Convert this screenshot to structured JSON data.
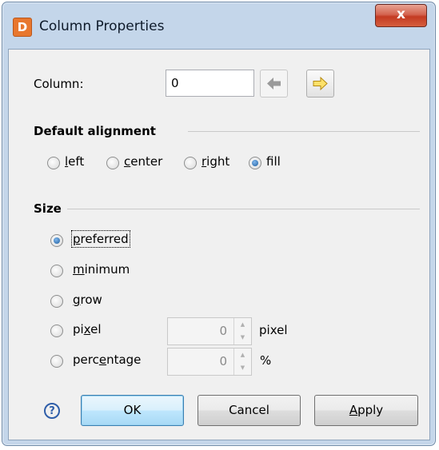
{
  "window": {
    "title": "Column Properties",
    "app_icon_glyph": "D",
    "close_glyph": "x"
  },
  "column": {
    "label": "Column:",
    "value": "0",
    "prev_icon": "arrow-left-icon",
    "next_icon": "arrow-right-icon"
  },
  "alignment": {
    "title": "Default alignment",
    "options": [
      {
        "id": "left",
        "mnemonic": "l",
        "rest": "eft",
        "selected": false
      },
      {
        "id": "center",
        "mnemonic": "c",
        "rest": "enter",
        "selected": false
      },
      {
        "id": "right",
        "mnemonic": "r",
        "rest": "ight",
        "selected": false
      },
      {
        "id": "fill",
        "pre": "f",
        "mnemonic": "i",
        "rest": "ll",
        "selected": true
      }
    ]
  },
  "size": {
    "title": "Size",
    "options": [
      {
        "id": "preferred",
        "mnemonic": "p",
        "rest": "referred",
        "selected": true,
        "focused": true
      },
      {
        "id": "minimum",
        "mnemonic": "m",
        "rest": "inimum",
        "selected": false
      },
      {
        "id": "grow",
        "mnemonic": "g",
        "rest": "row",
        "selected": false
      },
      {
        "id": "pixel",
        "pre": "pi",
        "mnemonic": "x",
        "rest": "el",
        "selected": false
      },
      {
        "id": "percentage",
        "pre": "perc",
        "mnemonic": "e",
        "rest": "ntage",
        "selected": false
      }
    ],
    "pixel_value": "0",
    "pixel_unit": "pixel",
    "percent_value": "0",
    "percent_unit": "%"
  },
  "buttons": {
    "help_glyph": "?",
    "ok": "OK",
    "cancel": "Cancel",
    "apply_mnemonic": "A",
    "apply_rest": "pply"
  },
  "colors": {
    "accent": "#3c7fb1",
    "app_icon": "#e8772e",
    "close": "#c33a23"
  }
}
